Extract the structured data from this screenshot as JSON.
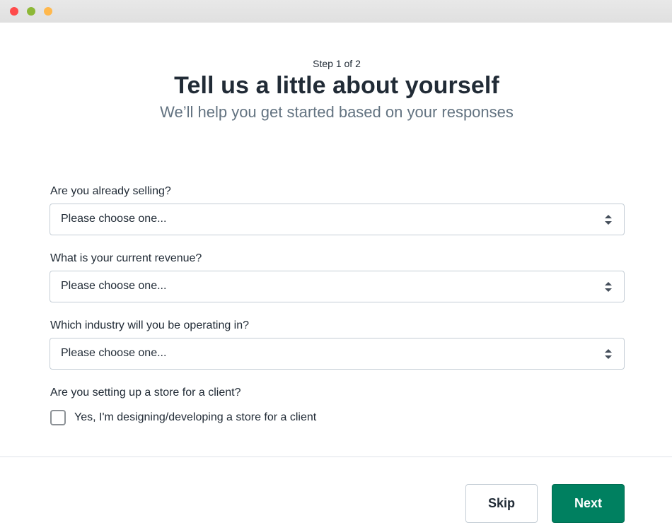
{
  "window": {
    "controls": [
      "close",
      "minimize",
      "maximize"
    ]
  },
  "header": {
    "step": "Step 1 of 2",
    "title": "Tell us a little about yourself",
    "subtitle": "We’ll help you get started based on your responses"
  },
  "form": {
    "fields": [
      {
        "label": "Are you already selling?",
        "value": "Please choose one..."
      },
      {
        "label": "What is your current revenue?",
        "value": "Please choose one..."
      },
      {
        "label": "Which industry will you be operating in?",
        "value": "Please choose one..."
      }
    ],
    "client_question": "Are you setting up a store for a client?",
    "client_checkbox_label": "Yes, I'm designing/developing a store for a client",
    "client_checkbox_checked": false
  },
  "footer": {
    "skip_label": "Skip",
    "next_label": "Next"
  },
  "colors": {
    "primary": "#008060",
    "text": "#212b36",
    "subdued": "#637381"
  }
}
